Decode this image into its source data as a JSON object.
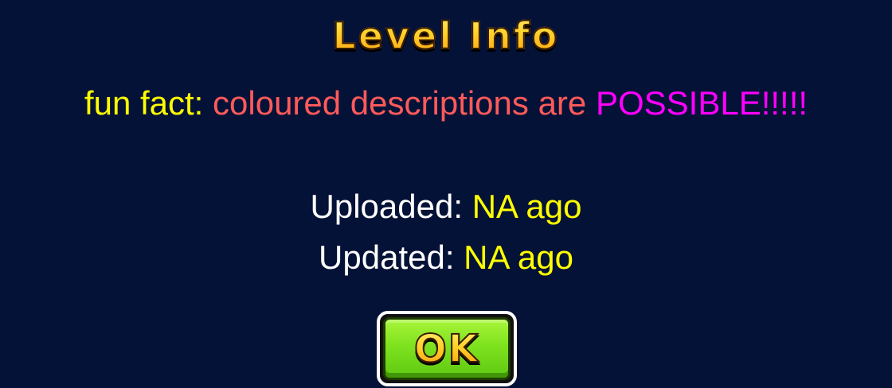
{
  "title": "Level Info",
  "description": {
    "segments": [
      {
        "text": "fun fact: ",
        "color": "#ffff00"
      },
      {
        "text": "coloured descriptions are ",
        "color": "#ff5a5a"
      },
      {
        "text": "POSSIBLE!!!!!",
        "color": "#ff00ff"
      }
    ]
  },
  "uploaded": {
    "label": "Uploaded: ",
    "value": "NA ago",
    "label_color": "#ffffff",
    "value_color": "#ffff00"
  },
  "updated": {
    "label": "Updated: ",
    "value": "NA ago",
    "label_color": "#ffffff",
    "value_color": "#ffff00"
  },
  "ok_button": {
    "label": "OK"
  },
  "colors": {
    "background": "#051237",
    "title_gold": "#ffd21a",
    "button_green": "#7ee21e"
  }
}
